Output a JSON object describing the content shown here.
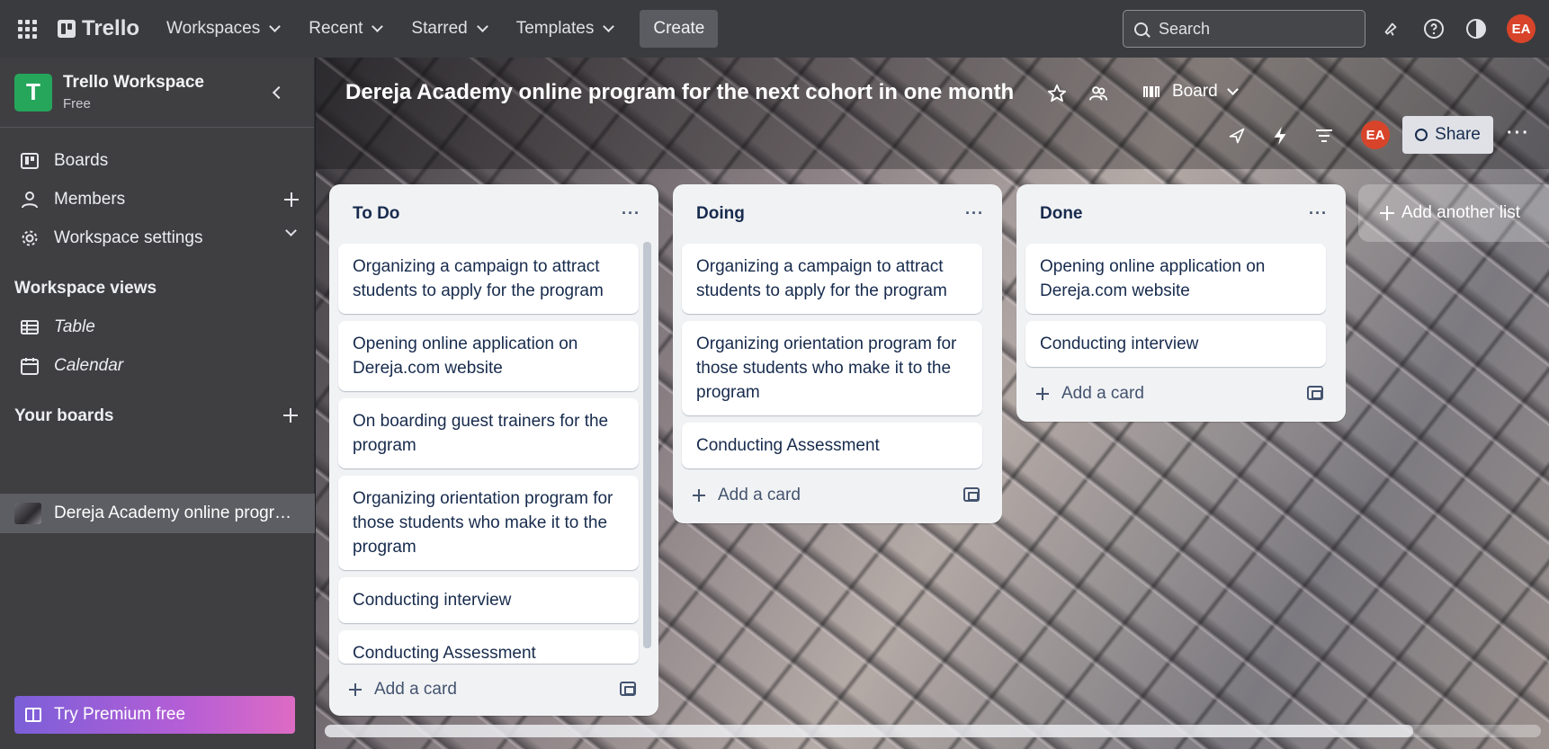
{
  "topbar": {
    "logo": "Trello",
    "menu": [
      "Workspaces",
      "Recent",
      "Starred",
      "Templates"
    ],
    "create_label": "Create",
    "search_placeholder": "Search",
    "avatar_initials": "EA"
  },
  "sidebar": {
    "workspace_initial": "T",
    "workspace_name": "Trello Workspace",
    "workspace_plan": "Free",
    "nav": [
      {
        "label": "Boards"
      },
      {
        "label": "Members"
      },
      {
        "label": "Workspace settings"
      }
    ],
    "views_title": "Workspace views",
    "views": [
      {
        "label": "Table"
      },
      {
        "label": "Calendar"
      }
    ],
    "your_boards_title": "Your boards",
    "boards": [
      {
        "label": "Dereja Academy online progra..."
      }
    ],
    "premium_label": "Try Premium free"
  },
  "board": {
    "title": "Dereja Academy online program for the next cohort in one month",
    "view_label": "Board",
    "member_initials": "EA",
    "share_label": "Share",
    "add_list_label": "Add another list",
    "lists": [
      {
        "title": "To Do",
        "cards": [
          "Organizing a campaign to attract students to apply for the program",
          "Opening online application on Dereja.com website",
          "On boarding guest trainers for the program",
          "Organizing orientation program for those students who make it to the program",
          "Conducting interview",
          "Conducting Assessment"
        ],
        "add_card_label": "Add a card"
      },
      {
        "title": "Doing",
        "cards": [
          "Organizing a campaign to attract students to apply for the program",
          "Organizing orientation program for those students who make it to the program",
          "Conducting Assessment"
        ],
        "add_card_label": "Add a card"
      },
      {
        "title": "Done",
        "cards": [
          "Opening online application on Dereja.com website",
          "Conducting interview"
        ],
        "add_card_label": "Add a card"
      }
    ]
  },
  "colors": {
    "topbar_bg": "#3a3b3f",
    "sidebar_bg": "#3f3f42",
    "workspace_logo": "#26a65b",
    "avatar": "#d8442a",
    "list_bg": "#f1f2f4"
  }
}
